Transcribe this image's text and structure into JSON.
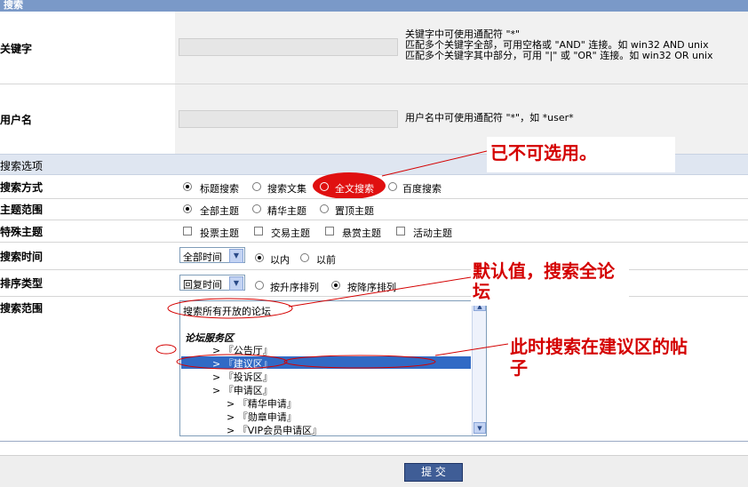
{
  "header": {
    "title": "搜索"
  },
  "keyword": {
    "label": "关键字",
    "value": "",
    "help": [
      "关键字中可使用通配符 \"*\"",
      "匹配多个关键字全部，可用空格或 \"AND\" 连接。如 win32 AND unix",
      "匹配多个关键字其中部分，可用 \"|\" 或 \"OR\" 连接。如 win32 OR unix"
    ]
  },
  "username": {
    "label": "用户名",
    "value": "",
    "help": "用户名中可使用通配符 \"*\"，如 *user*"
  },
  "options_header": "搜索选项",
  "search_method": {
    "label": "搜索方式",
    "options": [
      "标题搜索",
      "搜索文集",
      "全文搜索",
      "百度搜索"
    ],
    "selected": "标题搜索"
  },
  "topic_scope": {
    "label": "主题范围",
    "options": [
      "全部主题",
      "精华主题",
      "置顶主题"
    ],
    "selected": "全部主题"
  },
  "special_topic": {
    "label": "特殊主题",
    "options": [
      "投票主题",
      "交易主题",
      "悬赏主题",
      "活动主题"
    ]
  },
  "search_time": {
    "label": "搜索时间",
    "select_value": "全部时间",
    "options": [
      "以内",
      "以前"
    ],
    "selected": "以内"
  },
  "sort_type": {
    "label": "排序类型",
    "select_value": "回复时间",
    "options": [
      "按升序排列",
      "按降序排列"
    ],
    "selected": "按降序排列"
  },
  "search_scope": {
    "label": "搜索范围",
    "items": [
      "搜索所有开放的论坛",
      "论坛服务区",
      "> 『公告厅』",
      "> 『建议区』",
      "> 『投诉区』",
      "> 『申请区』",
      "> 『精华申请』",
      "> 『勋章申请』",
      "> 『VIP会员申请区』"
    ],
    "selected_item": "> 『建议区』"
  },
  "annotations": {
    "disabled_note": "已不可选用。",
    "default_note": "默认值，搜索全论坛",
    "suggest_note": "此时搜索在建议区的帖子"
  },
  "submit": {
    "label": "提 交"
  },
  "colors": {
    "header": "#7a99c8",
    "annotation_red": "#d40000",
    "selection": "#316ac5",
    "submit_bg": "#3f5d96"
  },
  "icons": [
    "dropdown-arrow-icon",
    "scroll-up-arrow-icon",
    "scroll-down-arrow-icon"
  ]
}
